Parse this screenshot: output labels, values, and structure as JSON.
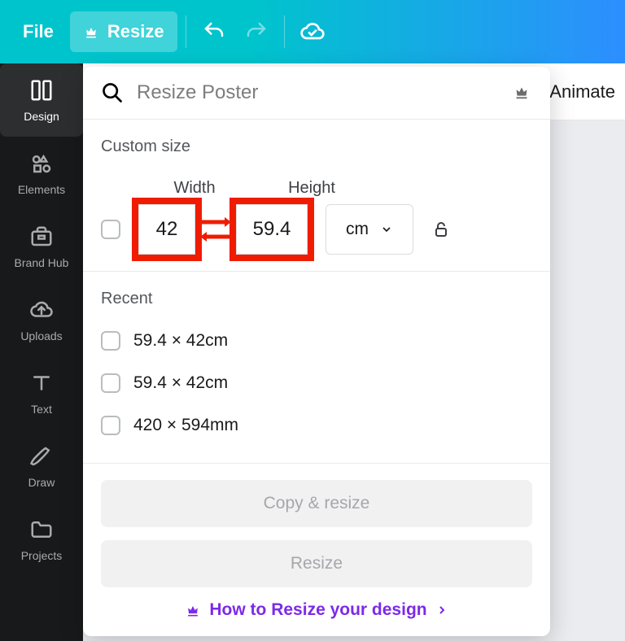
{
  "topbar": {
    "file": "File",
    "resize": "Resize"
  },
  "secbar": {
    "animate": "Animate"
  },
  "sidebar": {
    "items": [
      {
        "label": "Design"
      },
      {
        "label": "Elements"
      },
      {
        "label": "Brand Hub"
      },
      {
        "label": "Uploads"
      },
      {
        "label": "Text"
      },
      {
        "label": "Draw"
      },
      {
        "label": "Projects"
      }
    ]
  },
  "pop": {
    "search_placeholder": "Resize Poster",
    "custom_title": "Custom size",
    "width_label": "Width",
    "height_label": "Height",
    "width_value": "42",
    "height_value": "59.4",
    "unit": "cm",
    "recent_title": "Recent",
    "recent": [
      "59.4 × 42cm",
      "59.4 × 42cm",
      "420 × 594mm"
    ],
    "copy_resize": "Copy & resize",
    "resize": "Resize",
    "help": "How to Resize your design"
  }
}
